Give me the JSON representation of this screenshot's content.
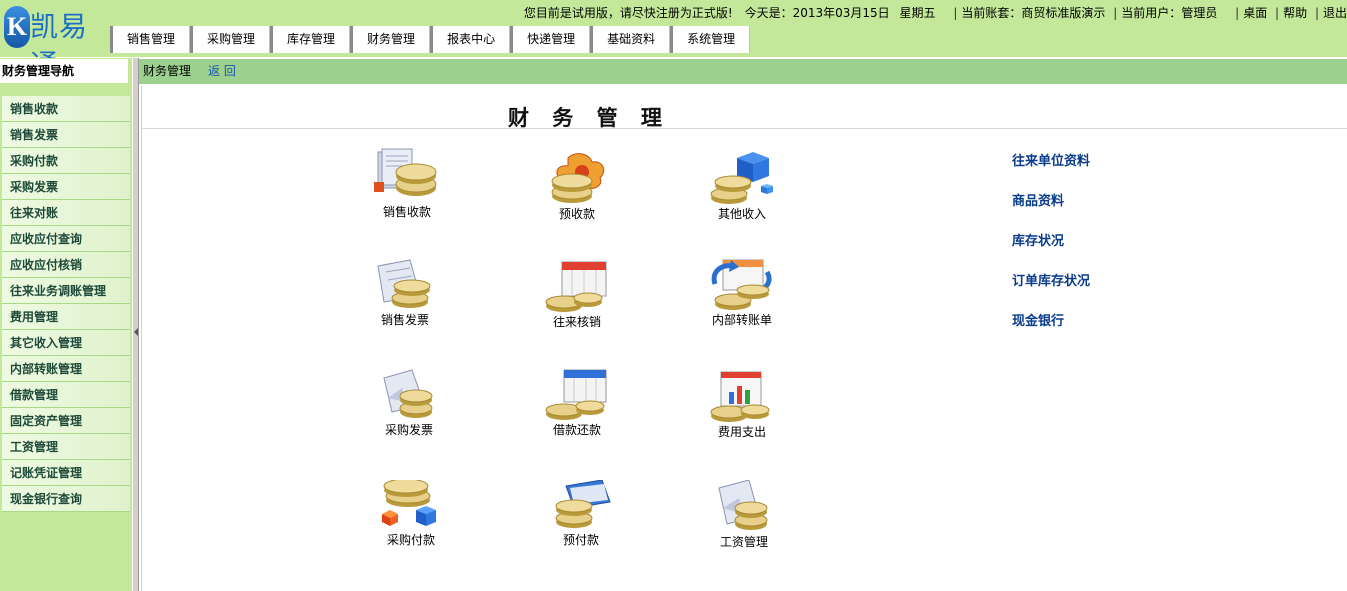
{
  "header": {
    "logo_letter": "K",
    "brand": "凯易通",
    "trial_notice": "您目前是试用版，请尽快注册为正式版!",
    "today_label": "今天是：",
    "date": "2013年03月15日",
    "weekday": "星期五",
    "account_label": "当前账套：",
    "account": "商贸标准版演示",
    "user_label": "当前用户：",
    "user": "管理员",
    "links": [
      "桌面",
      "帮助",
      "退出"
    ]
  },
  "menu": [
    "销售管理",
    "采购管理",
    "库存管理",
    "财务管理",
    "报表中心",
    "快递管理",
    "基础资料",
    "系统管理"
  ],
  "sidebar": {
    "title": "财务管理导航",
    "items": [
      "销售收款",
      "销售发票",
      "采购付款",
      "采购发票",
      "往来对账",
      "应收应付查询",
      "应收应付核销",
      "往来业务调账管理",
      "费用管理",
      "其它收入管理",
      "内部转账管理",
      "借款管理",
      "固定资产管理",
      "工资管理",
      "记账凭证管理",
      "现金银行查询"
    ]
  },
  "breadcrumb": {
    "current": "财务管理",
    "back": "返 回"
  },
  "page_title": "财 务 管 理",
  "tiles": [
    {
      "label": "销售收款",
      "icon": "coins-with-documents-icon"
    },
    {
      "label": "预收款",
      "icon": "coins-with-flower-icon"
    },
    {
      "label": "其他收入",
      "icon": "coins-with-blue-cube-icon"
    },
    {
      "label": "销售发票",
      "icon": "invoice-with-coins-icon"
    },
    {
      "label": "往来核销",
      "icon": "calendar-with-coins-icon"
    },
    {
      "label": "内部转账单",
      "icon": "transfer-arrows-with-coins-icon"
    },
    {
      "label": "采购发票",
      "icon": "purchase-invoice-icon"
    },
    {
      "label": "借款还款",
      "icon": "loan-calendar-with-coins-icon"
    },
    {
      "label": "费用支出",
      "icon": "expense-chart-with-coins-icon"
    },
    {
      "label": "采购付款",
      "icon": "coins-with-boxes-icon"
    },
    {
      "label": "预付款",
      "icon": "folder-with-coins-icon"
    },
    {
      "label": "工资管理",
      "icon": "salary-document-icon"
    }
  ],
  "side_links": [
    "往来单位资料",
    "商品资料",
    "库存状况",
    "订单库存状况",
    "现金银行"
  ],
  "colors": {
    "header_bg": "#c4e89a",
    "crumb_bg": "#9bd08f",
    "link": "#0a3c8c"
  }
}
